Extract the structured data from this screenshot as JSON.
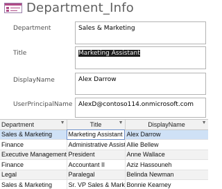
{
  "form": {
    "title": "Department_Info"
  },
  "fields": [
    {
      "label": "Department",
      "value": "Sales & Marketing"
    },
    {
      "label": "Title",
      "value": "Marketing Assistant"
    },
    {
      "label": "DisplayName",
      "value": "Alex Darrow"
    },
    {
      "label": "UserPrincipalName",
      "value": "AlexD@contoso114.onmicrosoft.com"
    }
  ],
  "datasheet": {
    "columns": [
      "Department",
      "Title",
      "DisplayName"
    ],
    "rows": [
      [
        "Sales & Marketing",
        "Marketing Assistant",
        "Alex Darrow"
      ],
      [
        "Finance",
        "Administrative Assistant",
        "Allie Bellew"
      ],
      [
        "Executive Management",
        "President",
        "Anne Wallace"
      ],
      [
        "Finance",
        "Accountant II",
        "Aziz Hassouneh"
      ],
      [
        "Legal",
        "Paralegal",
        "Belinda Newman"
      ],
      [
        "Sales & Marketing",
        "Sr. VP Sales & Marketing",
        "Bonnie Kearney"
      ]
    ]
  },
  "icons": {
    "form_icon": "form-icon",
    "sort_icon": "dropdown-arrow-icon"
  },
  "colors": {
    "selected_row": "#cfe1f6",
    "highlight_text_bg": "#1c1c1c",
    "icon_accent": "#b04b86"
  }
}
